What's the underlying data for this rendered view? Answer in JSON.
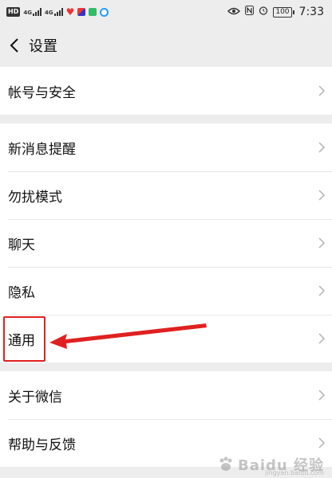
{
  "status_bar": {
    "hd_label": "HD",
    "network_1": "4G",
    "network_2": "4G",
    "battery": "100",
    "time": "7:33",
    "icons": [
      "hd-icon",
      "signal-icon",
      "signal-icon",
      "heart-app-icon",
      "app-icon",
      "wallet-app-icon",
      "browser-app-icon",
      "eye-icon",
      "nfc-icon",
      "alarm-icon",
      "battery-icon"
    ]
  },
  "navbar": {
    "back_icon": "chevron-left-icon",
    "title": "设置"
  },
  "groups": [
    {
      "items": [
        {
          "label": "帐号与安全"
        }
      ]
    },
    {
      "items": [
        {
          "label": "新消息提醒"
        },
        {
          "label": "勿扰模式"
        },
        {
          "label": "聊天"
        },
        {
          "label": "隐私"
        },
        {
          "label": "通用"
        }
      ]
    },
    {
      "items": [
        {
          "label": "关于微信"
        },
        {
          "label": "帮助与反馈"
        }
      ]
    }
  ],
  "annotation": {
    "highlight_target": "通用",
    "highlight_color": "#e02020"
  },
  "watermark": {
    "text": "Baidu 经验",
    "sub": "jingyan.baidu.com"
  }
}
